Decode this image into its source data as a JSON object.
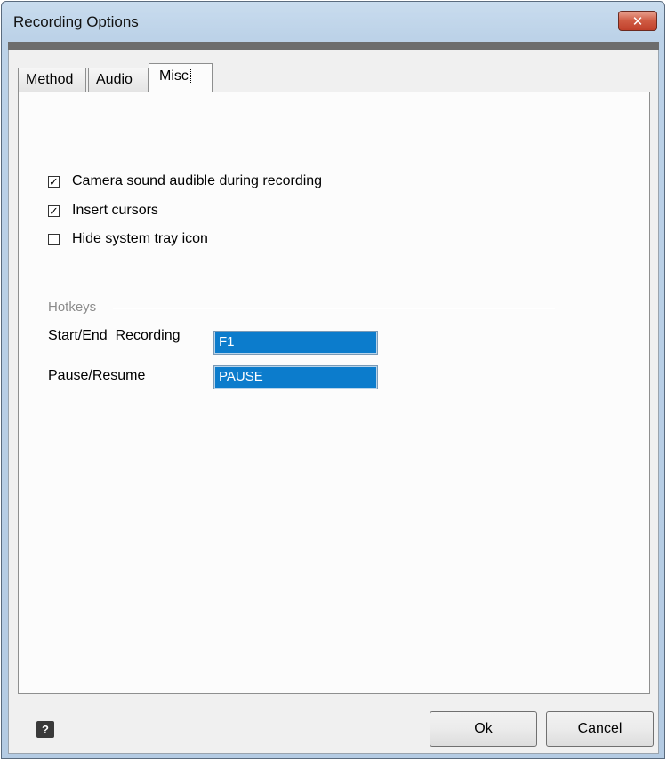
{
  "window": {
    "title": "Recording Options",
    "close_glyph": "✕"
  },
  "tabs": [
    {
      "label": "Method",
      "active": false
    },
    {
      "label": "Audio",
      "active": false
    },
    {
      "label": "Misc",
      "active": true
    }
  ],
  "options": [
    {
      "label": "Camera sound audible during recording",
      "checked": true
    },
    {
      "label": "Insert cursors",
      "checked": true
    },
    {
      "label": "Hide system tray icon",
      "checked": false
    }
  ],
  "hotkeys": {
    "group_label": "Hotkeys",
    "rows": [
      {
        "label": "Start/End  Recording",
        "value": "F1"
      },
      {
        "label": "Pause/Resume",
        "value": "PAUSE"
      }
    ]
  },
  "footer": {
    "help_glyph": "?",
    "ok_label": "Ok",
    "cancel_label": "Cancel"
  },
  "colors": {
    "hotkey_field_bg": "#0c7ccc",
    "close_button": "#c0402b"
  }
}
